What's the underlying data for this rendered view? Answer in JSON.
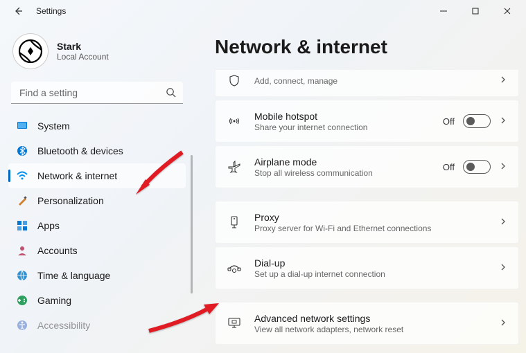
{
  "window": {
    "title": "Settings"
  },
  "profile": {
    "name": "Stark",
    "sub": "Local Account"
  },
  "search": {
    "placeholder": "Find a setting"
  },
  "sidebar": {
    "items": [
      {
        "label": "System"
      },
      {
        "label": "Bluetooth & devices"
      },
      {
        "label": "Network & internet"
      },
      {
        "label": "Personalization"
      },
      {
        "label": "Apps"
      },
      {
        "label": "Accounts"
      },
      {
        "label": "Time & language"
      },
      {
        "label": "Gaming"
      },
      {
        "label": "Accessibility"
      }
    ]
  },
  "page": {
    "title": "Network & internet"
  },
  "cards": {
    "vpn": {
      "sub": "Add, connect, manage"
    },
    "hotspot": {
      "title": "Mobile hotspot",
      "sub": "Share your internet connection",
      "state": "Off"
    },
    "airplane": {
      "title": "Airplane mode",
      "sub": "Stop all wireless communication",
      "state": "Off"
    },
    "proxy": {
      "title": "Proxy",
      "sub": "Proxy server for Wi-Fi and Ethernet connections"
    },
    "dialup": {
      "title": "Dial-up",
      "sub": "Set up a dial-up internet connection"
    },
    "advanced": {
      "title": "Advanced network settings",
      "sub": "View all network adapters, network reset"
    }
  }
}
